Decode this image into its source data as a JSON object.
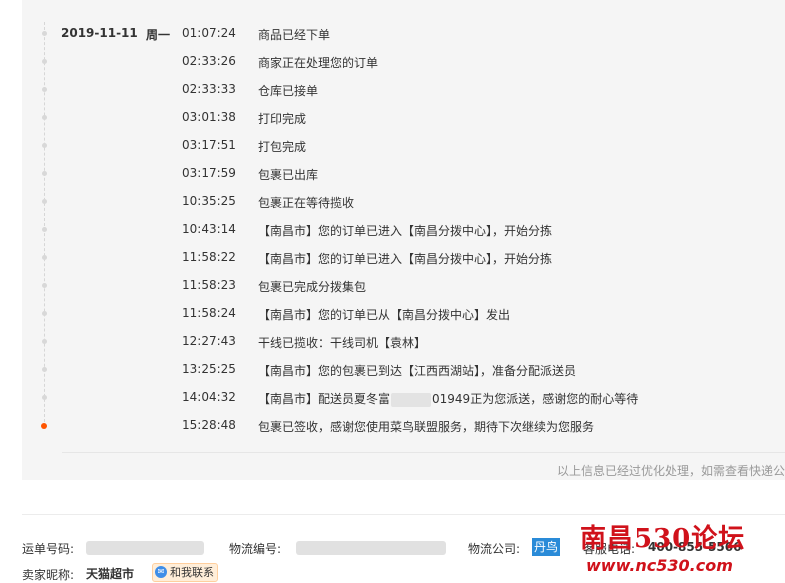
{
  "timeline": {
    "date": "2019-11-11",
    "weekday": "周一",
    "events": [
      {
        "time": "01:07:24",
        "text": "商品已经下单"
      },
      {
        "time": "02:33:26",
        "text": "商家正在处理您的订单"
      },
      {
        "time": "02:33:33",
        "text": "仓库已接单"
      },
      {
        "time": "03:01:38",
        "text": "打印完成"
      },
      {
        "time": "03:17:51",
        "text": "打包完成"
      },
      {
        "time": "03:17:59",
        "text": "包裹已出库"
      },
      {
        "time": "10:35:25",
        "text": "包裹正在等待揽收"
      },
      {
        "time": "10:43:14",
        "text": "【南昌市】您的订单已进入【南昌分拨中心】，开始分拣"
      },
      {
        "time": "11:58:22",
        "text": "【南昌市】您的订单已进入【南昌分拨中心】，开始分拣"
      },
      {
        "time": "11:58:23",
        "text": "包裹已完成分拨集包"
      },
      {
        "time": "11:58:24",
        "text": "【南昌市】您的订单已从【南昌分拨中心】发出"
      },
      {
        "time": "12:27:43",
        "text": "干线已揽收：干线司机【袁林】"
      },
      {
        "time": "13:25:25",
        "text": "【南昌市】您的包裹已到达【江西西湖站】，准备分配派送员"
      },
      {
        "time": "14:04:32",
        "text_before": "【南昌市】配送员夏冬富",
        "text_after": "01949正为您派送，感谢您的耐心等待"
      },
      {
        "time": "15:28:48",
        "text": "包裹已签收，感谢您使用菜鸟联盟服务，期待下次继续为您服务"
      }
    ]
  },
  "note": "以上信息已经过优化处理，如需查看快递公",
  "info": {
    "tracking_label": "运单号码:",
    "logistics_label": "物流编号:",
    "company_label": "物流公司:",
    "company_value": "丹鸟",
    "phone_label": "客服电话:",
    "phone_value": "400-855-5566",
    "seller_label": "卖家昵称:",
    "seller_name": "天猫超市",
    "contact_label": "和我联系"
  },
  "watermark": {
    "title": "南昌530论坛",
    "url": "www.nc530.com"
  },
  "colors": {
    "active_dot": "#ff5500",
    "watermark": "#d0121b",
    "company_tag": "#2a8bd8"
  }
}
